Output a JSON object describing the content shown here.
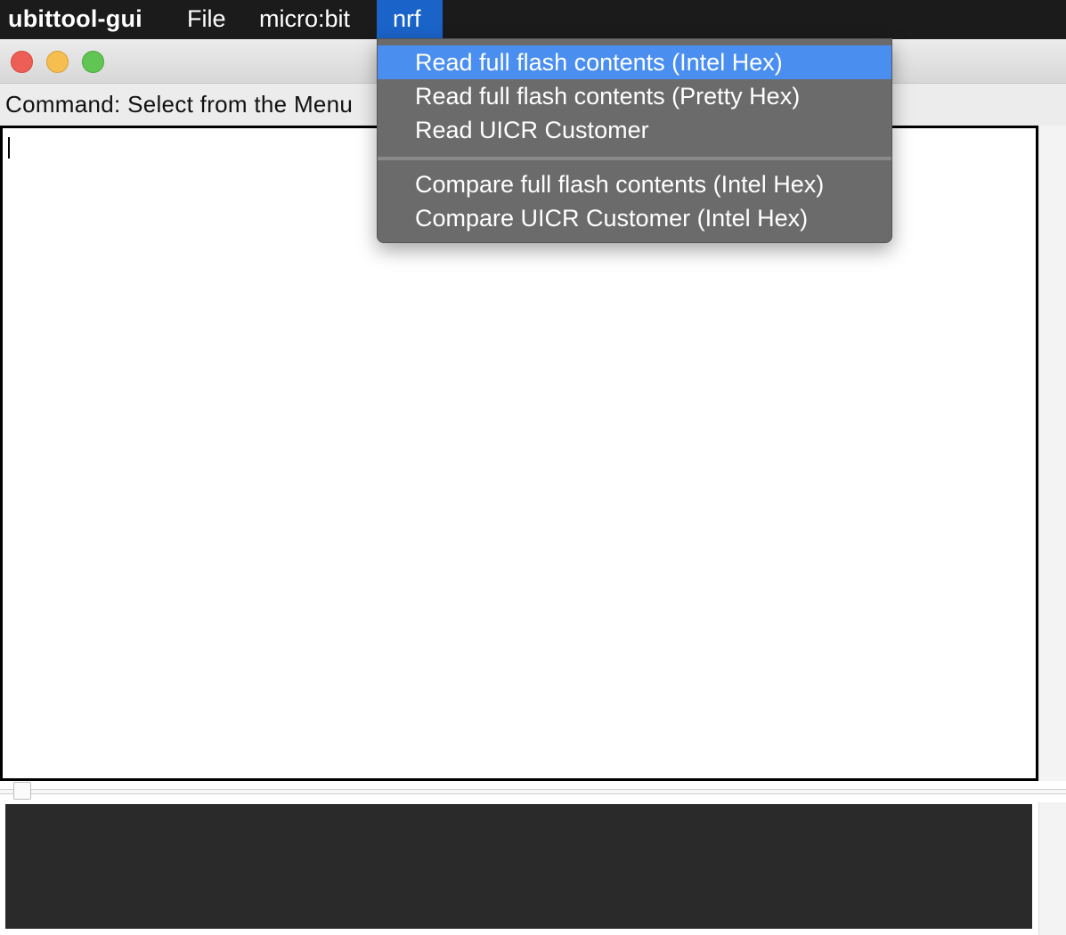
{
  "menubar": {
    "app_name": "ubittool-gui",
    "menus": [
      {
        "label": "File"
      },
      {
        "label": "micro:bit"
      },
      {
        "label": "nrf"
      }
    ]
  },
  "window": {
    "command_label": "Command: Select from the Menu",
    "editor_text": "",
    "console_text": ""
  },
  "nrf_menu": {
    "group1": [
      {
        "label": "Read full flash contents (Intel Hex)"
      },
      {
        "label": "Read full flash contents (Pretty Hex)"
      },
      {
        "label": "Read UICR Customer"
      }
    ],
    "group2": [
      {
        "label": "Compare full flash contents (Intel Hex)"
      },
      {
        "label": "Compare UICR Customer (Intel Hex)"
      }
    ]
  },
  "colors": {
    "menubar_bg": "#1b1b1b",
    "menu_active": "#1a63c8",
    "dropdown_bg": "#6b6b6b",
    "highlight": "#4a8ef0",
    "console_bg": "#2a2a2a"
  }
}
